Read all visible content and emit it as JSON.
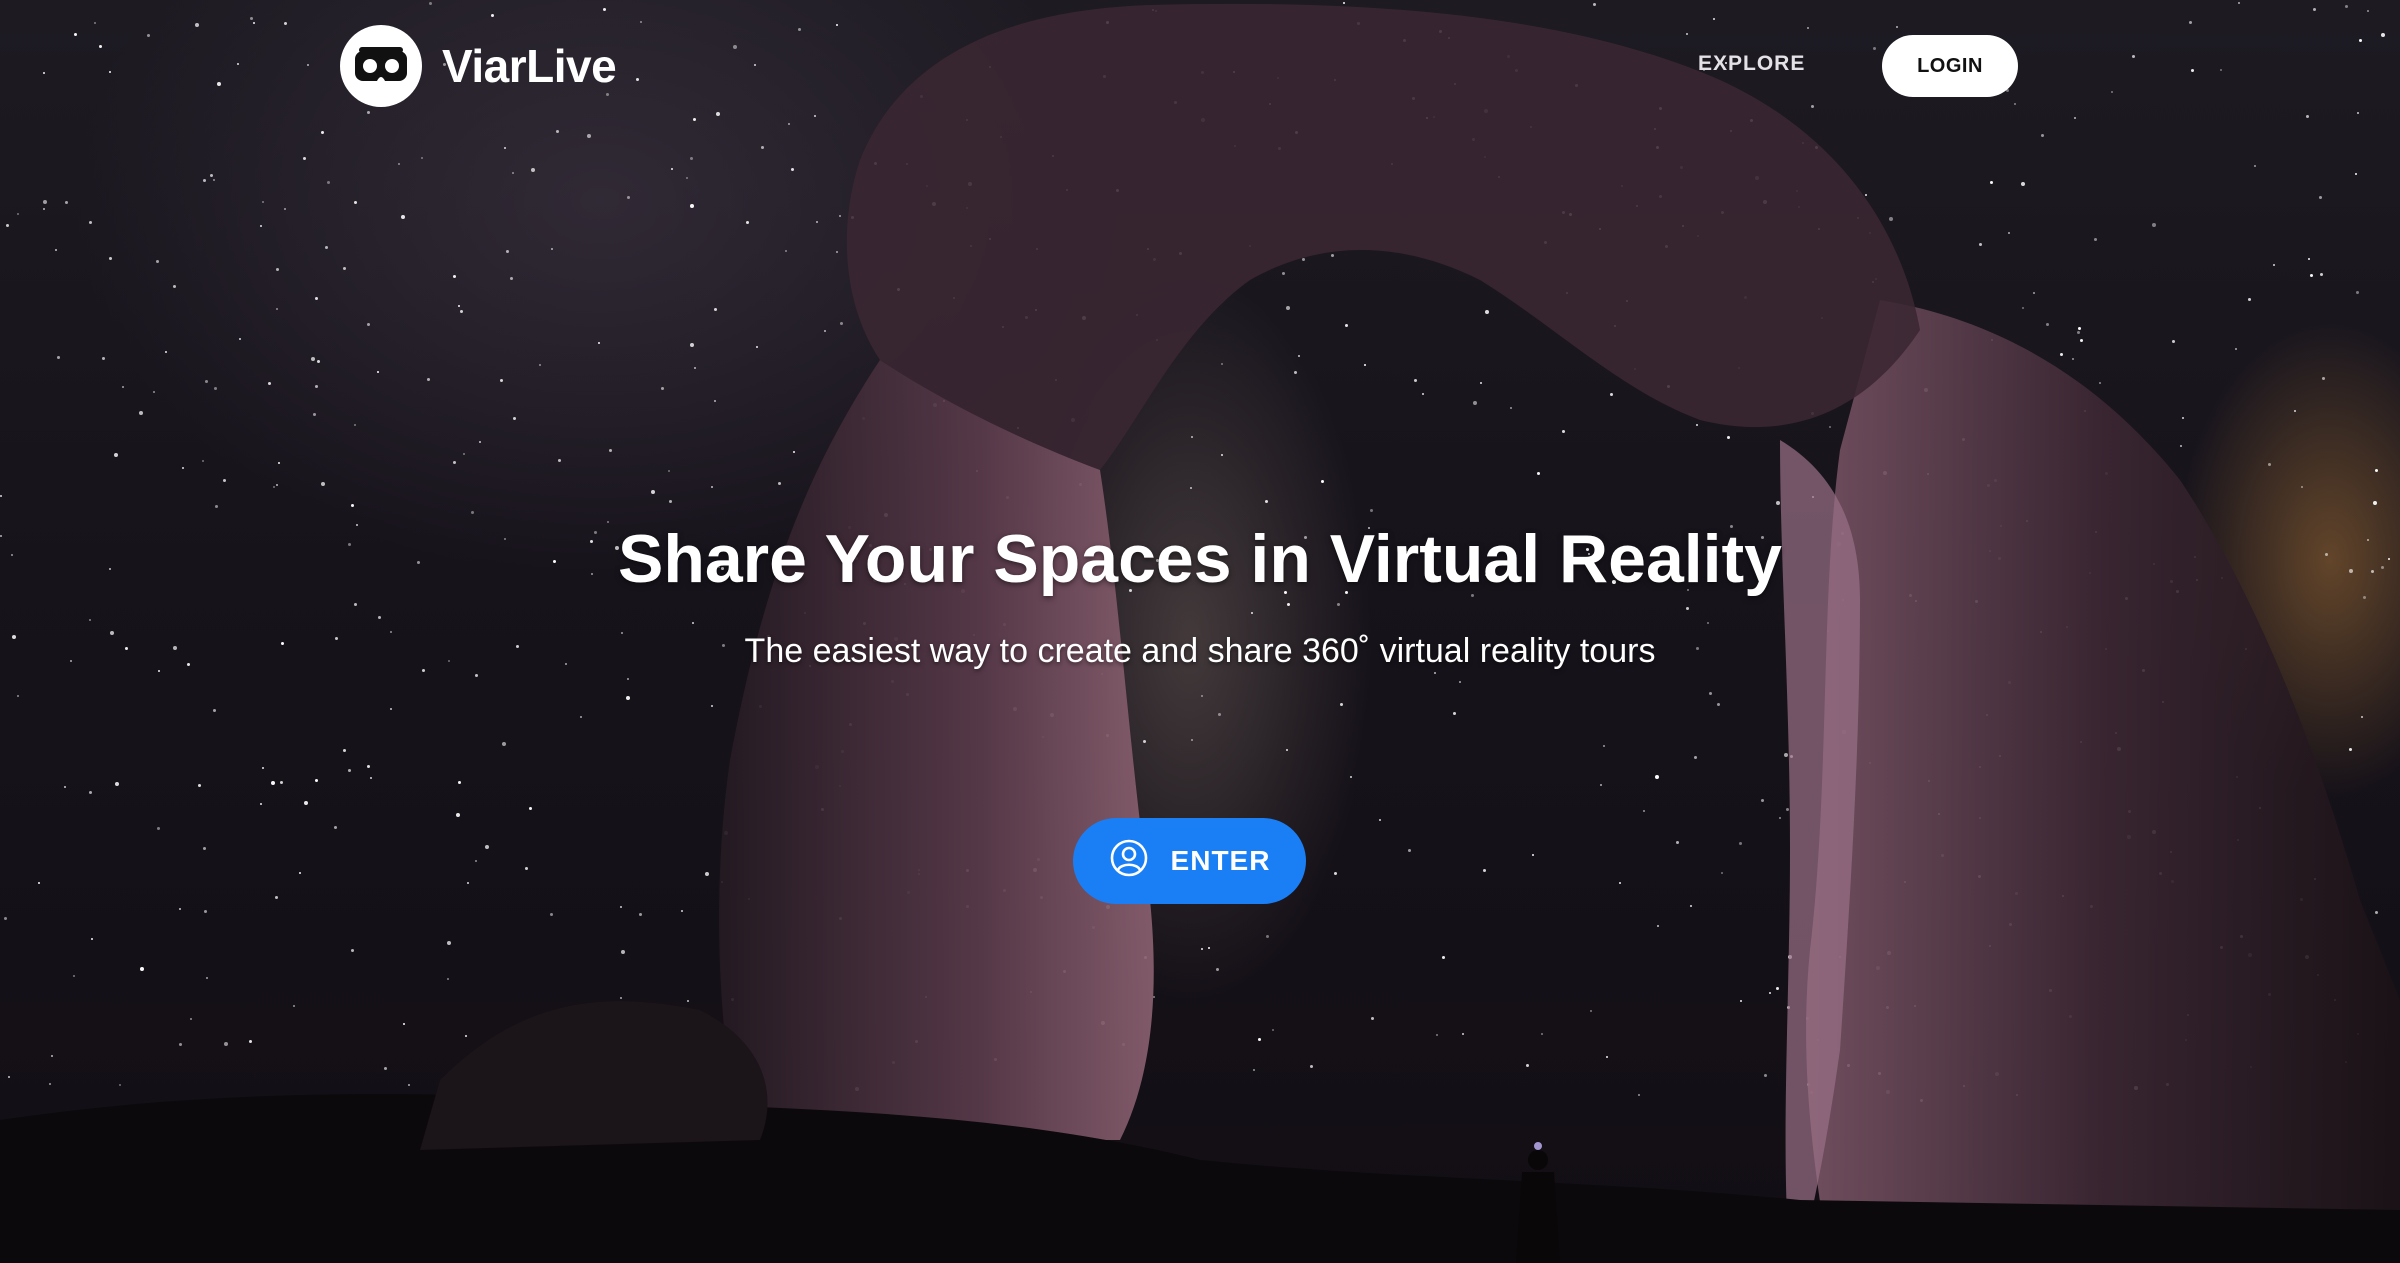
{
  "header": {
    "brand": "ViarLive",
    "logo_icon": "vr-headset-icon",
    "nav": {
      "explore_label": "EXPLORE",
      "login_label": "LOGIN"
    }
  },
  "hero": {
    "title": "Share Your Spaces in Virtual Reality",
    "subtitle": "The easiest way to create and share 360˚ virtual reality tours",
    "cta_label": "ENTER",
    "cta_icon": "user-circle-icon"
  },
  "colors": {
    "accent": "#1a7ff5",
    "background": "#15111a"
  }
}
